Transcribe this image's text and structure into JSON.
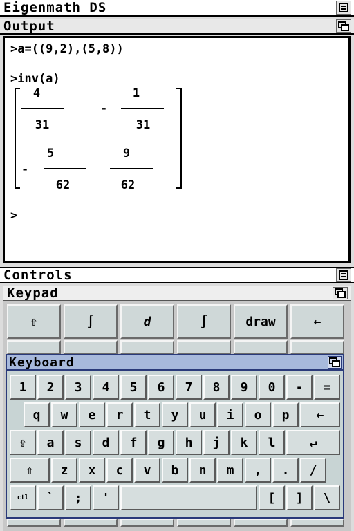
{
  "app": {
    "title": "Eigenmath DS"
  },
  "output": {
    "title": "Output",
    "input1": ">a=((9,2),(5,8))",
    "input2": ">inv(a)",
    "prompt": ">",
    "matrix": {
      "r1c1": {
        "num": "4",
        "den": "31"
      },
      "r1c2": {
        "sign": "-",
        "num": "1",
        "den": "31"
      },
      "r2c1": {
        "sign": "-",
        "num": "5",
        "den": "62"
      },
      "r2c2": {
        "num": "9",
        "den": "62"
      }
    }
  },
  "controls": {
    "title": "Controls"
  },
  "keypad": {
    "title": "Keypad",
    "keys": [
      "⇧",
      "∫",
      "d",
      "∫",
      "draw",
      "←"
    ]
  },
  "keyboard": {
    "title": "Keyboard",
    "row1": [
      "1",
      "2",
      "3",
      "4",
      "5",
      "6",
      "7",
      "8",
      "9",
      "0",
      "-",
      "="
    ],
    "row2": [
      "q",
      "w",
      "e",
      "r",
      "t",
      "y",
      "u",
      "i",
      "o",
      "p",
      "←"
    ],
    "row3": [
      "⇪",
      "a",
      "s",
      "d",
      "f",
      "g",
      "h",
      "j",
      "k",
      "l",
      "↵"
    ],
    "row4": [
      "⇧",
      "z",
      "x",
      "c",
      "v",
      "b",
      "n",
      "m",
      ",",
      ".",
      "/"
    ],
    "row5": [
      "ctl",
      "`",
      ";",
      "'",
      " ",
      "[",
      "]",
      "\\"
    ]
  },
  "icons": {
    "window_minimize": "minimize-icon",
    "window_restore": "restore-icon"
  }
}
